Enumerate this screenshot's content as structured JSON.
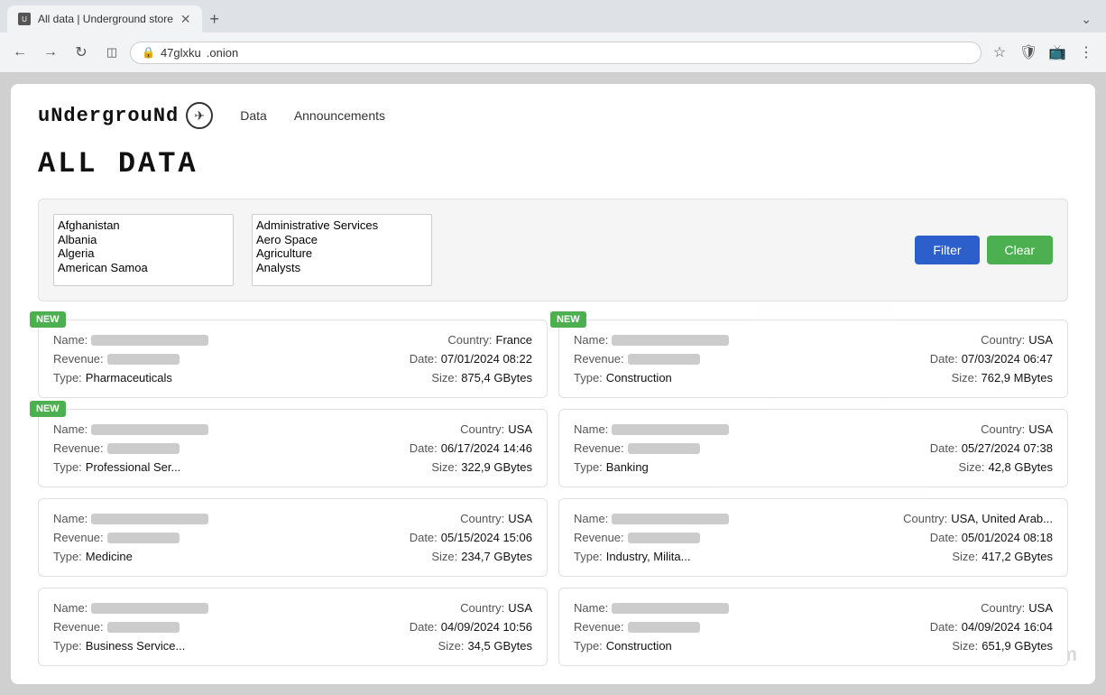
{
  "browser": {
    "tab_title": "All data | Underground store",
    "tab_favicon": "U",
    "url_left": "47glxku",
    "url_right": ".onion",
    "new_tab_icon": "+",
    "overflow_icon": "⌄"
  },
  "nav": {
    "logo_text": "uNdergrouNd",
    "logo_icon": "✈",
    "data_link": "Data",
    "announcements_link": "Announcements"
  },
  "page": {
    "title": "ALL DATA"
  },
  "filter": {
    "countries": [
      "Afghanistan",
      "Albania",
      "Algeria",
      "American Samoa"
    ],
    "industries": [
      "Administrative Services",
      "Aero Space",
      "Agriculture",
      "Analysts"
    ],
    "filter_button": "Filter",
    "clear_button": "Clear"
  },
  "cards": [
    {
      "new": true,
      "name_label": "Name:",
      "name_value": "",
      "country_label": "Country:",
      "country_value": "France",
      "revenue_label": "Revenue:",
      "revenue_value": "",
      "date_label": "Date:",
      "date_value": "07/01/2024 08:22",
      "type_label": "Type:",
      "type_value": "Pharmaceuticals",
      "size_label": "Size:",
      "size_value": "875,4 GBytes"
    },
    {
      "new": true,
      "name_label": "Name:",
      "name_value": "",
      "country_label": "Country:",
      "country_value": "USA",
      "revenue_label": "Revenue:",
      "revenue_value": "",
      "date_label": "Date:",
      "date_value": "07/03/2024 06:47",
      "type_label": "Type:",
      "type_value": "Construction",
      "size_label": "Size:",
      "size_value": "762,9 MBytes"
    },
    {
      "new": true,
      "name_label": "Name:",
      "name_value": "",
      "country_label": "Country:",
      "country_value": "USA",
      "revenue_label": "Revenue:",
      "revenue_value": "",
      "date_label": "Date:",
      "date_value": "06/17/2024 14:46",
      "type_label": "Type:",
      "type_value": "Professional Ser...",
      "size_label": "Size:",
      "size_value": "322,9 GBytes"
    },
    {
      "new": false,
      "name_label": "Name:",
      "name_value": "",
      "country_label": "Country:",
      "country_value": "USA",
      "revenue_label": "Revenue:",
      "revenue_value": "",
      "date_label": "Date:",
      "date_value": "05/27/2024 07:38",
      "type_label": "Type:",
      "type_value": "Banking",
      "size_label": "Size:",
      "size_value": "42,8 GBytes"
    },
    {
      "new": false,
      "name_label": "Name:",
      "name_value": "",
      "country_label": "Country:",
      "country_value": "USA",
      "revenue_label": "Revenue:",
      "revenue_value": "",
      "date_label": "Date:",
      "date_value": "05/15/2024 15:06",
      "type_label": "Type:",
      "type_value": "Medicine",
      "size_label": "Size:",
      "size_value": "234,7 GBytes"
    },
    {
      "new": false,
      "name_label": "Name:",
      "name_value": "",
      "country_label": "Country:",
      "country_value": "USA, United Arab...",
      "revenue_label": "Revenue:",
      "revenue_value": "",
      "date_label": "Date:",
      "date_value": "05/01/2024 08:18",
      "type_label": "Type:",
      "type_value": "Industry, Milita...",
      "size_label": "Size:",
      "size_value": "417,2 GBytes"
    },
    {
      "new": false,
      "name_label": "Name:",
      "name_value": "",
      "country_label": "Country:",
      "country_value": "USA",
      "revenue_label": "Revenue:",
      "revenue_value": "",
      "date_label": "Date:",
      "date_value": "04/09/2024 10:56",
      "type_label": "Type:",
      "type_value": "Business Service...",
      "size_label": "Size:",
      "size_value": "34,5 GBytes"
    },
    {
      "new": false,
      "name_label": "Name:",
      "name_value": "",
      "country_label": "Country:",
      "country_value": "USA",
      "revenue_label": "Revenue:",
      "revenue_value": "",
      "date_label": "Date:",
      "date_value": "04/09/2024 16:04",
      "type_label": "Type:",
      "type_value": "Construction",
      "size_label": "Size:",
      "size_value": "651,9 GBytes"
    }
  ],
  "watermark": {
    "firewall_text": "Thor...firewall.com"
  }
}
